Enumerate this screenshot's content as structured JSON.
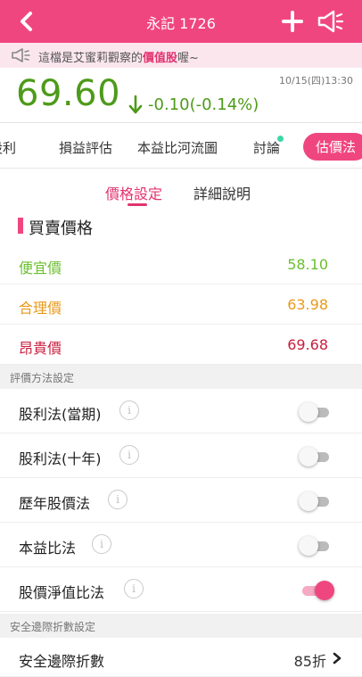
{
  "header": {
    "title": "永記 1726"
  },
  "notice": {
    "text_before": "這檔是艾蜜莉觀察的",
    "highlight": "價值股",
    "text_after": "喔~"
  },
  "quote": {
    "price": "69.60",
    "change": "-0.10(-0.14%)",
    "time": "10/15(四)13:30",
    "color": "#4e9a1a"
  },
  "tabs": [
    {
      "label": "股利"
    },
    {
      "label": "損益評估"
    },
    {
      "label": "本益比河流圖"
    },
    {
      "label": "討論"
    },
    {
      "label": "估價法"
    }
  ],
  "subtabs": {
    "price_setting": "價格設定",
    "detail": "詳細說明"
  },
  "prices": {
    "title": "買賣價格",
    "cheap": {
      "label": "便宜價",
      "value": "58.10",
      "color": "#6bbf2e"
    },
    "fair": {
      "label": "合理價",
      "value": "63.98",
      "color": "#e89a1c"
    },
    "expensive": {
      "label": "昂貴價",
      "value": "69.68",
      "color": "#c81e3e"
    }
  },
  "methods": {
    "header": "評價方法設定",
    "items": [
      {
        "label": "股利法(當期)",
        "enabled": false
      },
      {
        "label": "股利法(十年)",
        "enabled": false
      },
      {
        "label": "歷年股價法",
        "enabled": false
      },
      {
        "label": "本益比法",
        "enabled": false
      },
      {
        "label": "股價淨值比法",
        "enabled": true
      }
    ]
  },
  "margin": {
    "header": "安全邊際折數設定",
    "label": "安全邊際折數",
    "value": "85折"
  },
  "colors": {
    "accent": "#f0467f",
    "notice_bg": "#fbe6ee"
  }
}
